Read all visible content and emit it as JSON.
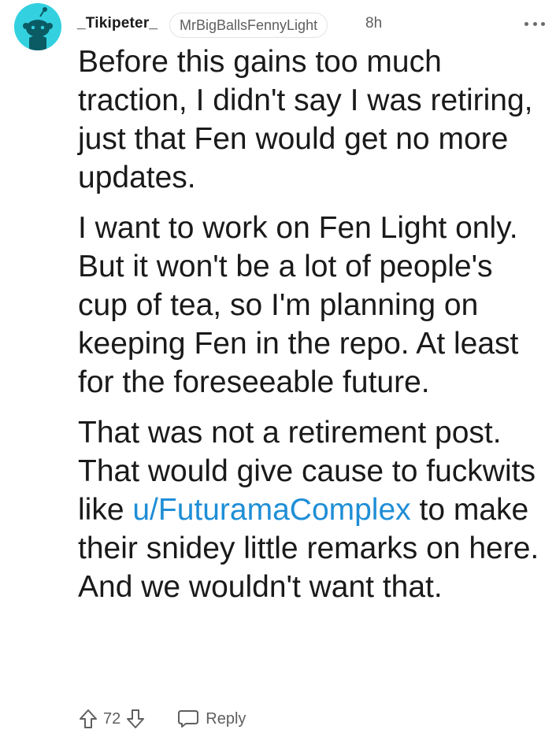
{
  "comment": {
    "author": "_Tikipeter_",
    "flair": "MrBigBallsFennyLight",
    "age": "8h",
    "avatar_icon": "snoo-avatar-icon",
    "avatar_bg": "#33d1e0",
    "paragraphs": {
      "p1": "Before this gains too much traction, I didn't say I was retiring, just that Fen would get no more updates.",
      "p2": "I want to work on Fen Light only. But it won't be a lot of people's cup of tea, so I'm planning on keeping Fen in the repo. At least for the foreseeable future.",
      "p3_before": "That was not a retirement post. That would give cause to fuckwits like ",
      "p3_link": "u/FuturamaComplex",
      "p3_after": " to make their snidey little remarks on here. And we wouldn't want that."
    },
    "link_color": "#1f8ed6",
    "score": "72",
    "reply_label": "Reply",
    "icons": {
      "more": "more-options-icon",
      "upvote": "upvote-arrow-icon",
      "downvote": "downvote-arrow-icon",
      "reply": "reply-bubble-icon"
    }
  }
}
